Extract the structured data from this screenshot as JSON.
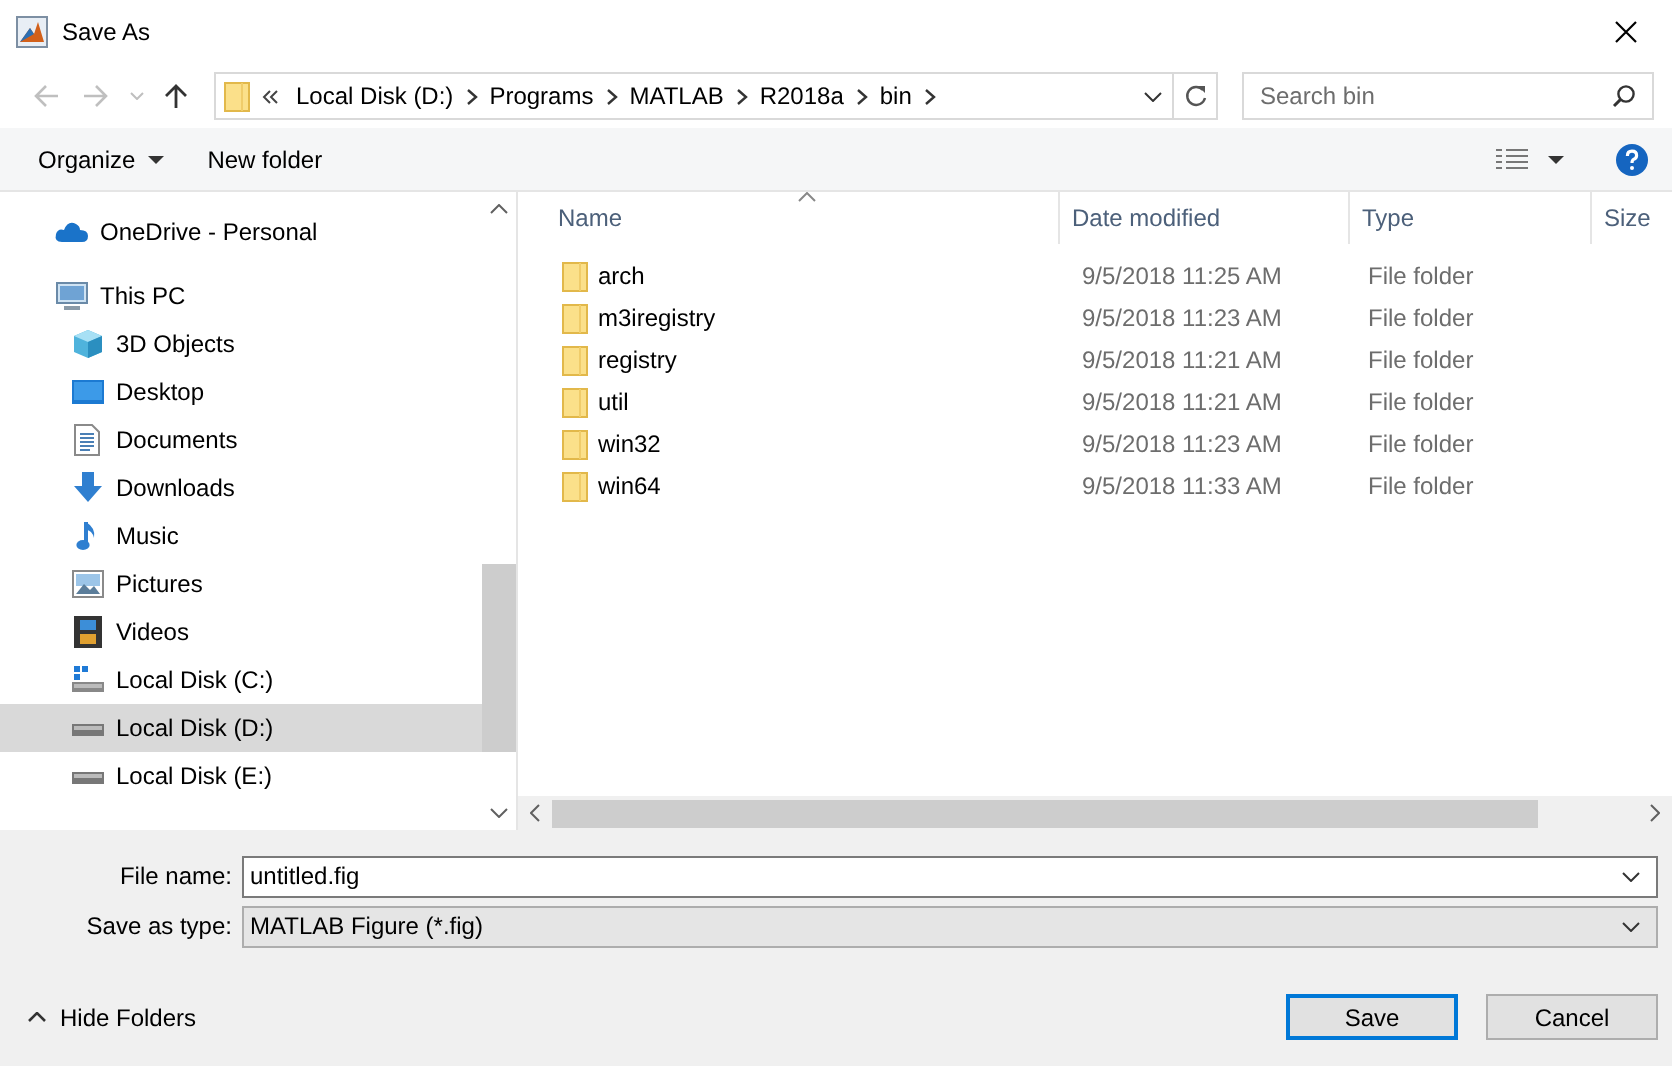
{
  "window": {
    "title": "Save As"
  },
  "address_bar": {
    "path": [
      "Local Disk (D:)",
      "Programs",
      "MATLAB",
      "R2018a",
      "bin"
    ]
  },
  "search": {
    "placeholder": "Search bin"
  },
  "toolbar": {
    "organize": "Organize",
    "new_folder": "New folder"
  },
  "sidebar": {
    "items": [
      {
        "label": "OneDrive - Personal",
        "kind": "onedrive",
        "selected": false
      },
      {
        "label": "This PC",
        "kind": "pc",
        "selected": false,
        "children": [
          {
            "label": "3D Objects",
            "kind": "objects3d",
            "selected": false
          },
          {
            "label": "Desktop",
            "kind": "desktop",
            "selected": false
          },
          {
            "label": "Documents",
            "kind": "documents",
            "selected": false
          },
          {
            "label": "Downloads",
            "kind": "downloads",
            "selected": false
          },
          {
            "label": "Music",
            "kind": "music",
            "selected": false
          },
          {
            "label": "Pictures",
            "kind": "pictures",
            "selected": false
          },
          {
            "label": "Videos",
            "kind": "videos",
            "selected": false
          },
          {
            "label": "Local Disk (C:)",
            "kind": "system-disk",
            "selected": false
          },
          {
            "label": "Local Disk (D:)",
            "kind": "disk",
            "selected": true
          },
          {
            "label": "Local Disk (E:)",
            "kind": "disk",
            "selected": false
          }
        ]
      }
    ]
  },
  "file_list": {
    "columns": [
      "Name",
      "Date modified",
      "Type",
      "Size"
    ],
    "rows": [
      {
        "name": "arch",
        "date": "9/5/2018 11:25 AM",
        "type": "File folder"
      },
      {
        "name": "m3iregistry",
        "date": "9/5/2018 11:23 AM",
        "type": "File folder"
      },
      {
        "name": "registry",
        "date": "9/5/2018 11:21 AM",
        "type": "File folder"
      },
      {
        "name": "util",
        "date": "9/5/2018 11:21 AM",
        "type": "File folder"
      },
      {
        "name": "win32",
        "date": "9/5/2018 11:23 AM",
        "type": "File folder"
      },
      {
        "name": "win64",
        "date": "9/5/2018 11:33 AM",
        "type": "File folder"
      }
    ]
  },
  "file_name": {
    "label": "File name:",
    "value": "untitled.fig"
  },
  "save_type": {
    "label": "Save as type:",
    "value": "MATLAB Figure (*.fig)"
  },
  "hide_folders": "Hide Folders",
  "buttons": [
    {
      "label": "Save",
      "default": true
    },
    {
      "label": "Cancel",
      "default": false
    }
  ]
}
